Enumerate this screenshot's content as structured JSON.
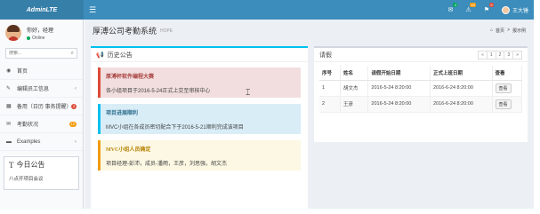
{
  "app": {
    "logo": "AdminLTE"
  },
  "topbar": {
    "menu_icon": "hamburger-icon",
    "mail_badge": "4",
    "notify_badge": "10",
    "tasks_badge": "9",
    "user_name": "王大锤",
    "colors": {
      "mail": "#00a65a",
      "notify": "#f39c12",
      "tasks": "#dd4b39"
    }
  },
  "sidebar": {
    "greeting": "你好，经理",
    "status": "Online",
    "search_placeholder": "搜索...",
    "items": [
      {
        "label": "首页",
        "icon": "dashboard-icon",
        "right": ""
      },
      {
        "label": "编辑员工信息",
        "icon": "edit-icon",
        "right": "‹"
      },
      {
        "label": "备用（日历 事务提醒）",
        "icon": "calendar-icon",
        "right": "",
        "pill": "3",
        "pill_color": "#dd4b39"
      },
      {
        "label": "考勤状况",
        "icon": "envelope-icon",
        "right": "",
        "pill": "12",
        "pill_color": "#f39c12"
      },
      {
        "label": "Examples",
        "icon": "folder-icon",
        "right": "‹"
      }
    ],
    "today": {
      "title": "今日公告",
      "text": "八点开项目会议"
    }
  },
  "header": {
    "title": "厚溥公司考勤系统",
    "subtitle": "HOPE",
    "breadcrumb_home": "首页",
    "breadcrumb_current": "报示例"
  },
  "history": {
    "title": "历史公告",
    "callouts": [
      {
        "title": "厚溥杯软件编程大赛",
        "text": "各小组项目于2016-5-24正式上交至审核中心"
      },
      {
        "title": "项目进展顺利",
        "text": "MVC小组在各成员密切配合下于2016-5-21顺利完成该项目"
      },
      {
        "title": "MVC小组人员确定",
        "text": "项目经理-彭沛，成员-潘雨，王彦，刘思强，胡文杰"
      }
    ]
  },
  "leave": {
    "title": "请假",
    "pager": [
      "«",
      "1",
      "2",
      "3",
      "»"
    ],
    "columns": [
      "序号",
      "姓名",
      "请假开始日期",
      "正式上班日期",
      "查看"
    ],
    "rows": [
      {
        "no": "1",
        "name": "胡文杰",
        "start": "2016-5-24 8:20:00",
        "end": "2016-6-24 8:20:00",
        "action": "查看"
      },
      {
        "no": "2",
        "name": "王彦",
        "start": "2016-5-24 8:20:00",
        "end": "2016-6-24 8:20:00",
        "action": "查看"
      }
    ]
  }
}
